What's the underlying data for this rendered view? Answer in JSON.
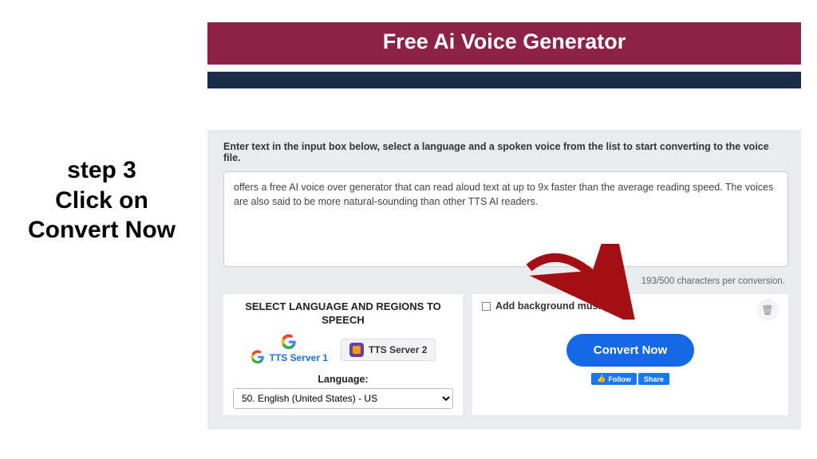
{
  "left": {
    "line1": "step 3",
    "line2": "Click on",
    "line3": "Convert Now"
  },
  "header": {
    "title": "Free Ai Voice Generator"
  },
  "form": {
    "instruction": "Enter text in the input box below, select a language and a spoken voice from the list to start converting to the voice file.",
    "textValue": "offers a free AI voice over generator that can read aloud text at up to 9x faster than the average reading speed. The voices are also said to be more natural-sounding than other TTS AI readers.",
    "counter": "193/500 characters per conversion."
  },
  "lang": {
    "heading": "SELECT LANGUAGE AND REGIONS TO SPEECH",
    "server1": "TTS Server 1",
    "server2": "TTS Server 2",
    "label": "Language:",
    "selected": "50. English (United States) - US"
  },
  "convert": {
    "addMusic": "Add background music",
    "button": "Convert Now",
    "fbFollow": "Follow",
    "fbShare": "Share"
  }
}
